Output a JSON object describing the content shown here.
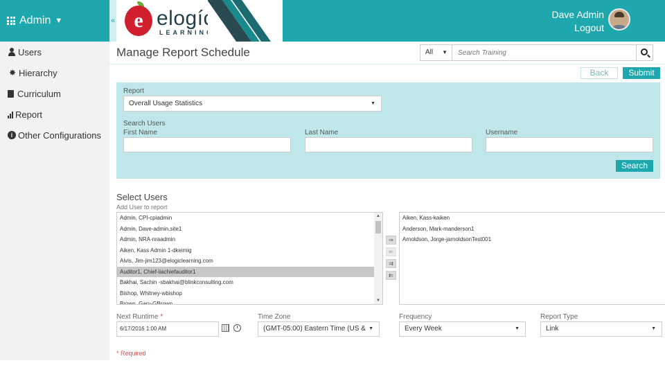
{
  "header": {
    "admin_label": "Admin",
    "collapse_glyph": "«",
    "logo_word": "elogíc",
    "logo_sub": "LEARNING",
    "user_name": "Dave Admin",
    "logout_label": "Logout",
    "colors": {
      "brand": "#1ea8ad",
      "logo_red": "#d0202e"
    }
  },
  "sidebar": {
    "items": [
      {
        "label": "Users",
        "icon": "user-icon"
      },
      {
        "label": "Hierarchy",
        "icon": "sitemap-icon"
      },
      {
        "label": "Curriculum",
        "icon": "book-icon"
      },
      {
        "label": "Report",
        "icon": "bar-chart-icon"
      },
      {
        "label": "Other Configurations",
        "icon": "info-icon"
      }
    ]
  },
  "main": {
    "title": "Manage Report Schedule",
    "search": {
      "scope": "All",
      "placeholder": "Search Training"
    },
    "back_label": "Back",
    "submit_label": "Submit"
  },
  "filter": {
    "report_label": "Report",
    "report_value": "Overall Usage Statistics",
    "search_users_label": "Search Users",
    "first_name_label": "First Name",
    "last_name_label": "Last Name",
    "username_label": "Username",
    "search_button": "Search"
  },
  "select_users": {
    "title": "Select Users",
    "subtitle": "Add User to report",
    "available": [
      "Admin, CPI-cpiadmin",
      "Admin, Dave-admin.site1",
      "Admin, NRA-nraadmin",
      "Aiken, Kass Admin 1-dkeimig",
      "Alvis, Jim-jim123@elogiclearning.com",
      "Auditor1, Chief-iiachiefauditor1",
      "Bakhai, Sachin -sbakhai@blinkconsulting.com",
      "Bishop, Whitney-wbishop",
      "Brown, Gary-GBrown"
    ],
    "selected_index": 5,
    "chosen": [
      "Aiken, Kass-kaiken",
      "Anderson, Mark-manderson1",
      "Arnoldson, Jorge-jarnoldsonTest001"
    ],
    "move_buttons": [
      "⇒",
      "⇐",
      "⇉",
      "⇇"
    ]
  },
  "schedule": {
    "next_runtime_label": "Next Runtime",
    "required_mark": "*",
    "next_runtime_value": "6/17/2016 1:00 AM",
    "timezone_label": "Time Zone",
    "timezone_value": "(GMT-05:00) Eastern Time (US &",
    "frequency_label": "Frequency",
    "frequency_value": "Every Week",
    "report_type_label": "Report Type",
    "report_type_value": "Link",
    "required_note": "* Required"
  }
}
